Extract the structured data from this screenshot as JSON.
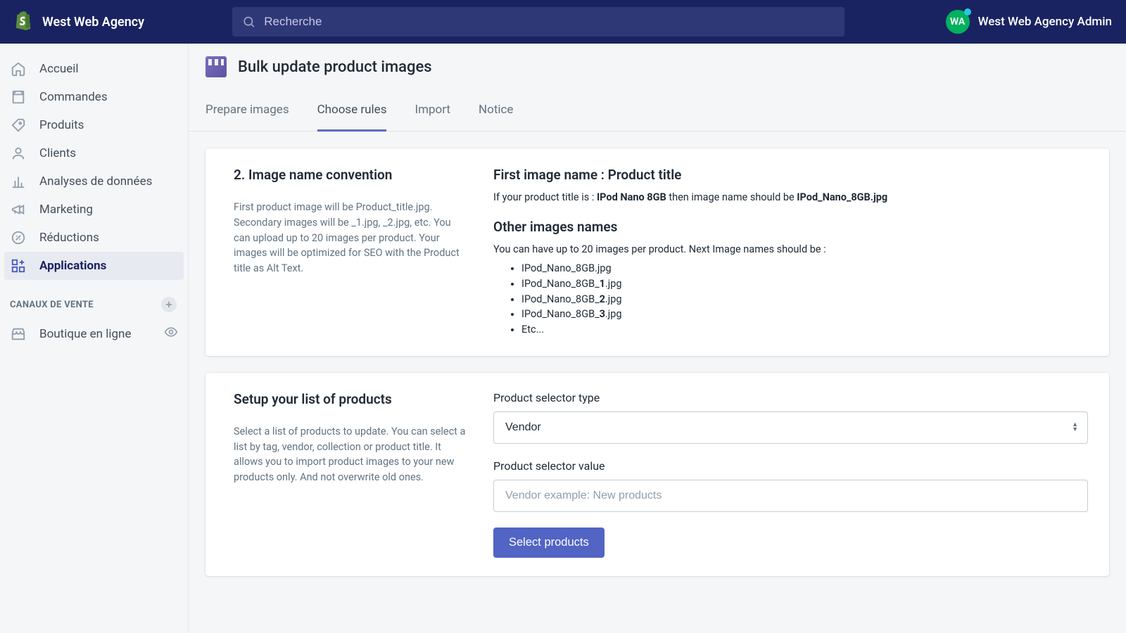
{
  "header": {
    "store_name": "West Web Agency",
    "search_placeholder": "Recherche",
    "avatar_initials": "WA",
    "user_label": "West Web Agency Admin"
  },
  "sidebar": {
    "items": [
      {
        "label": "Accueil"
      },
      {
        "label": "Commandes"
      },
      {
        "label": "Produits"
      },
      {
        "label": "Clients"
      },
      {
        "label": "Analyses de données"
      },
      {
        "label": "Marketing"
      },
      {
        "label": "Réductions"
      },
      {
        "label": "Applications"
      }
    ],
    "channels_heading": "CANAUX DE VENTE",
    "channel_item": "Boutique en ligne"
  },
  "app": {
    "title": "Bulk update product images",
    "tabs": [
      "Prepare images",
      "Choose rules",
      "Import",
      "Notice"
    ],
    "active_tab": 1
  },
  "section1": {
    "left_title": "2. Image name convention",
    "left_desc": "First product image will be Product_title.jpg. Secondary images will be _1.jpg, _2.jpg, etc. You can upload up to 20 images per product. Your images will be optimized for SEO with the Product title as Alt Text.",
    "right_h1": "First image name : Product title",
    "right_sub_prefix": "If your product title is : ",
    "right_sub_bold": "IPod Nano 8GB",
    "right_sub_mid": " then image name should be ",
    "right_sub_bold2": "IPod_Nano_8GB.jpg",
    "right_h2": "Other images names",
    "right_help": "You can have up to 20 images per product. Next Image names should be :",
    "list": [
      {
        "t": "IPod_Nano_8GB.jpg"
      },
      {
        "pre": "IPod_Nano_8GB_",
        "b": "1",
        "suf": ".jpg"
      },
      {
        "pre": "IPod_Nano_8GB_",
        "b": "2",
        "suf": ".jpg"
      },
      {
        "pre": "IPod_Nano_8GB_",
        "b": "3",
        "suf": ".jpg"
      },
      {
        "t": "Etc..."
      }
    ]
  },
  "section2": {
    "left_title": "Setup your list of products",
    "left_desc": "Select a list of products to update. You can select a list by tag, vendor, collection or product title. It allows you to import product images to your new products only. And not overwrite old ones.",
    "selector_type_label": "Product selector type",
    "selector_type_value": "Vendor",
    "selector_value_label": "Product selector value",
    "selector_value_placeholder": "Vendor example: New products",
    "button_label": "Select products"
  }
}
